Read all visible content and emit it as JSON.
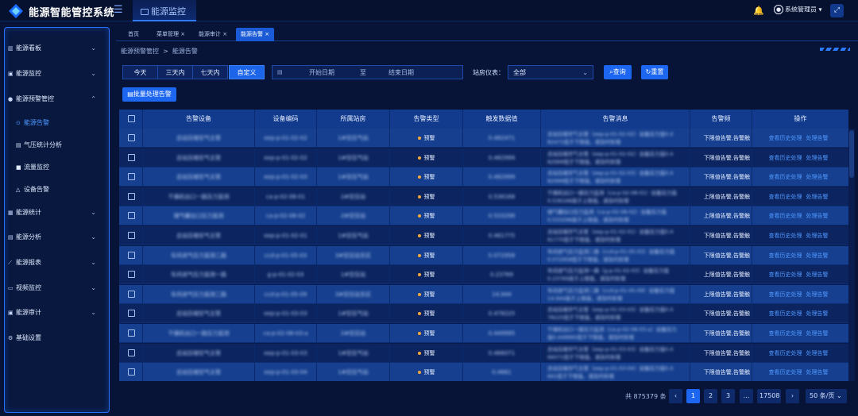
{
  "app": {
    "title": "能源智能管控系统",
    "module_tab": "能源监控"
  },
  "header": {
    "user_name": "系统管理员",
    "user_caret": "▾"
  },
  "sidebar": {
    "items": [
      {
        "label": "能源看板",
        "icon": "chart-bar-icon",
        "expanded": false
      },
      {
        "label": "能源监控",
        "icon": "monitor-icon",
        "expanded": false
      },
      {
        "label": "能源预警管控",
        "icon": "location-pin-icon",
        "expanded": true
      },
      {
        "label": "能源统计",
        "icon": "stats-icon",
        "expanded": false
      },
      {
        "label": "能源分析",
        "icon": "analysis-icon",
        "expanded": false
      },
      {
        "label": "能源报表",
        "icon": "line-chart-icon",
        "expanded": false
      },
      {
        "label": "视频监控",
        "icon": "video-icon",
        "expanded": false
      },
      {
        "label": "能源审计",
        "icon": "audit-icon",
        "expanded": false
      },
      {
        "label": "基础设置",
        "icon": "gear-icon",
        "expanded": false
      }
    ],
    "sub_items": [
      {
        "label": "能源告警",
        "icon": "alarm-icon",
        "active": true
      },
      {
        "label": "气压统计分析",
        "icon": "gauge-icon",
        "active": false
      },
      {
        "label": "流量监控",
        "icon": "flow-icon",
        "active": false
      },
      {
        "label": "设备告警",
        "icon": "bell-icon",
        "active": false
      }
    ]
  },
  "tabs": [
    {
      "label": "首页",
      "closable": false,
      "active": false
    },
    {
      "label": "菜单管理",
      "closable": true,
      "active": false
    },
    {
      "label": "能源审计",
      "closable": true,
      "active": false
    },
    {
      "label": "能源告警",
      "closable": true,
      "active": true
    }
  ],
  "breadcrumb": {
    "parent": "能源预警管控",
    "separator": ">",
    "current": "能源告警"
  },
  "filter": {
    "ranges": [
      {
        "label": "今天",
        "active": false
      },
      {
        "label": "三天内",
        "active": false
      },
      {
        "label": "七天内",
        "active": false
      },
      {
        "label": "自定义",
        "active": true
      }
    ],
    "start_placeholder": "开始日期",
    "to_label": "至",
    "end_placeholder": "结束日期",
    "station_label": "站房仪表：",
    "station_value": "全部",
    "query_label": "查询",
    "reset_label": "重置",
    "batch_label": "批量处理告警"
  },
  "table": {
    "columns": [
      "告警设备",
      "设备编码",
      "所属站房",
      "告警类型",
      "触发数据值",
      "告警消息",
      "告警频",
      "操作"
    ],
    "rows": [
      {
        "device": "总站压缩空气主管",
        "code": "eep-p-01-02-02",
        "station": "1#空压气站",
        "type": "预警",
        "value": "0.482471",
        "msg1": "总站压缩空气主管（eep-p-01-02-02）设备压力值0.4",
        "msg2": "82471低于下限值，请及时处理",
        "level": "下限值告警,告警触",
        "op1": "查看历史处理",
        "op2": "处理告警"
      },
      {
        "device": "总站压缩空气主管",
        "code": "eep-p-01-02-02",
        "station": "1#空压气站",
        "type": "预警",
        "value": "0.482999",
        "msg1": "总站压缩空气主管（eep-p-01-02-02）设备压力值0.4",
        "msg2": "82999低于下限值，请及时处理",
        "level": "下限值告警,告警触",
        "op1": "查看历史处理",
        "op2": "处理告警"
      },
      {
        "device": "总站压缩空气主管",
        "code": "eep-p-01-02-03",
        "station": "1#空压气站",
        "type": "预警",
        "value": "0.482999",
        "msg1": "总站压缩空气主管（eep-p-01-02-03）设备压力值0.4",
        "msg2": "82999低于下限值，请及时处理",
        "level": "下限值告警,告警触",
        "op1": "查看历史处理",
        "op2": "处理告警"
      },
      {
        "device": "干燥机出口一路压力监测",
        "code": "ca-p-02-08-01",
        "station": "2#空压站",
        "type": "预警",
        "value": "0.536168",
        "msg1": "干燥机出口一路压力监测（ca-p-02-08-01）设备压力值",
        "msg2": "0.536168高于上限值，请及时处理",
        "level": "上限值告警,告警触",
        "op1": "查看历史处理",
        "op2": "处理告警"
      },
      {
        "device": "储气罐出口压力监测",
        "code": "ca-p-02-08-02",
        "station": "2#空压站",
        "type": "预警",
        "value": "0.533298",
        "msg1": "储气罐出口压力监测（ca-p-02-08-02）设备压力值",
        "msg2": "0.533298高于上限值，请及时处理",
        "level": "上限值告警,告警触",
        "op1": "查看历史处理",
        "op2": "处理告警"
      },
      {
        "device": "总站压缩空气主管",
        "code": "eep-p-01-02-01",
        "station": "1#空压气站",
        "type": "预警",
        "value": "0.461775",
        "msg1": "总站压缩空气主管（eep-p-01-02-01）设备压力值0.4",
        "msg2": "61775低于下限值，请及时处理",
        "level": "下限值告警,告警触",
        "op1": "查看历史处理",
        "op2": "处理告警"
      },
      {
        "device": "车间进气压力监测二路",
        "code": "ccd-p-01-05-03",
        "station": "3#空压站东区",
        "type": "预警",
        "value": "0.072958",
        "msg1": "车间进气压力监测二路（ccd-p-01-05-03）设备压力值",
        "msg2": "0.072958低于下限值，请及时处理",
        "level": "下限值告警,告警触",
        "op1": "查看历史处理",
        "op2": "处理告警"
      },
      {
        "device": "车间进气压力监测一路",
        "code": "g-p-01-02-03",
        "station": "1#空压站",
        "type": "预警",
        "value": "0.23769",
        "msg1": "车间进气压力监测一路（g-p-01-02-03）设备压力值",
        "msg2": "0.23769高于上限值，请及时处理",
        "level": "上限值告警,告警触",
        "op1": "查看历史处理",
        "op2": "处理告警"
      },
      {
        "device": "车间进气压力监测二路",
        "code": "ccd-p-01-05-09",
        "station": "3#空压站东区",
        "type": "预警",
        "value": "14.944",
        "msg1": "车间进气压力监测二路（ccd-p-01-05-09）设备压力值",
        "msg2": "14.944高于上限值，请及时处理",
        "level": "上限值告警,告警触",
        "op1": "查看历史处理",
        "op2": "处理告警"
      },
      {
        "device": "总站压缩空气主管",
        "code": "eep-p-01-03-03",
        "station": "1#空压气站",
        "type": "预警",
        "value": "0.478225",
        "msg1": "总站压缩空气主管（eep-p-01-03-03）设备压力值0.4",
        "msg2": "78225低于下限值，请及时处理",
        "level": "下限值告警,告警触",
        "op1": "查看历史处理",
        "op2": "处理告警"
      },
      {
        "device": "干燥机出口一路压力监测",
        "code": "ca-p-02-08-03-a",
        "station": "2#空压站",
        "type": "预警",
        "value": "0.449995",
        "msg1": "干燥机出口一路压力监测（ca-p-02-08-03-a）设备压力",
        "msg2": "值0.449995低于下限值，请及时处理",
        "level": "下限值告警,告警触",
        "op1": "查看历史处理",
        "op2": "处理告警"
      },
      {
        "device": "总站压缩空气主管",
        "code": "eep-p-01-03-03",
        "station": "1#空压气站",
        "type": "预警",
        "value": "0.466071",
        "msg1": "总站压缩空气主管（eep-p-01-03-03）设备压力值0.4",
        "msg2": "66071低于下限值，请及时处理",
        "level": "下限值告警,告警触",
        "op1": "查看历史处理",
        "op2": "处理告警"
      },
      {
        "device": "总站压缩空气主管",
        "code": "eep-p-01-03-04",
        "station": "1#空压气站",
        "type": "预警",
        "value": "0.4661",
        "msg1": "总站压缩空气主管（eep-p-01-03-04）设备压力值0.4",
        "msg2": "661低于下限值，请及时处理",
        "level": "下限值告警,告警触",
        "op1": "查看历史处理",
        "op2": "处理告警"
      }
    ]
  },
  "pagination": {
    "total_text": "共 875379 条",
    "pages": [
      "1",
      "2",
      "3"
    ],
    "ellipsis": "...",
    "last_page": "17508",
    "page_size": "50 条/页",
    "current_page": 1
  },
  "colors": {
    "accent": "#1d66f0",
    "background": "#071437",
    "warning_dot": "#f7a83a"
  }
}
